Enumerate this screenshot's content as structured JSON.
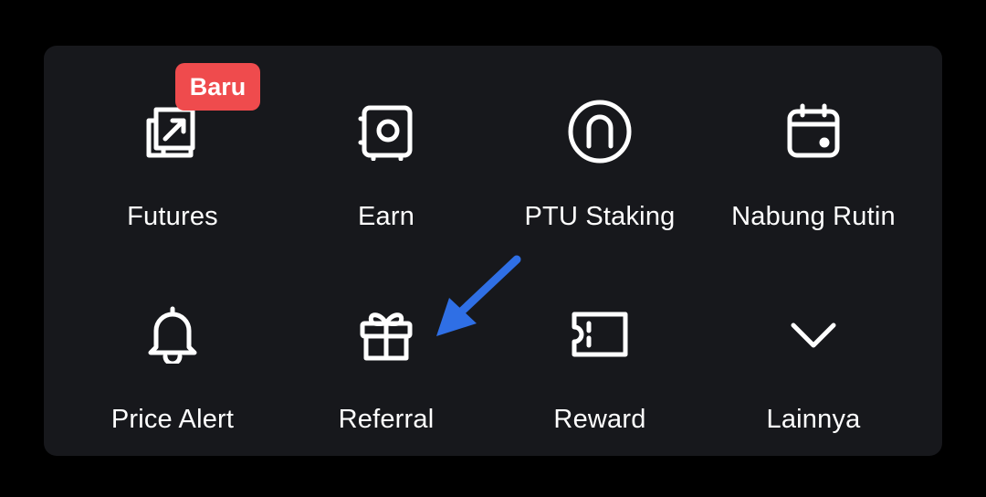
{
  "menu": {
    "items": [
      {
        "label": "Futures",
        "icon": "futures-icon"
      },
      {
        "label": "Earn",
        "icon": "safe-icon"
      },
      {
        "label": "PTU Staking",
        "icon": "ptu-icon"
      },
      {
        "label": "Nabung Rutin",
        "icon": "calendar-icon"
      },
      {
        "label": "Price Alert",
        "icon": "bell-icon"
      },
      {
        "label": "Referral",
        "icon": "gift-icon"
      },
      {
        "label": "Reward",
        "icon": "ticket-icon"
      },
      {
        "label": "Lainnya",
        "icon": "chevron-down-icon"
      }
    ],
    "badge": "Baru"
  },
  "colors": {
    "background": "#000000",
    "panel": "#17181c",
    "text": "#ffffff",
    "badge": "#ef4b4d",
    "arrow": "#2f6fe5"
  }
}
